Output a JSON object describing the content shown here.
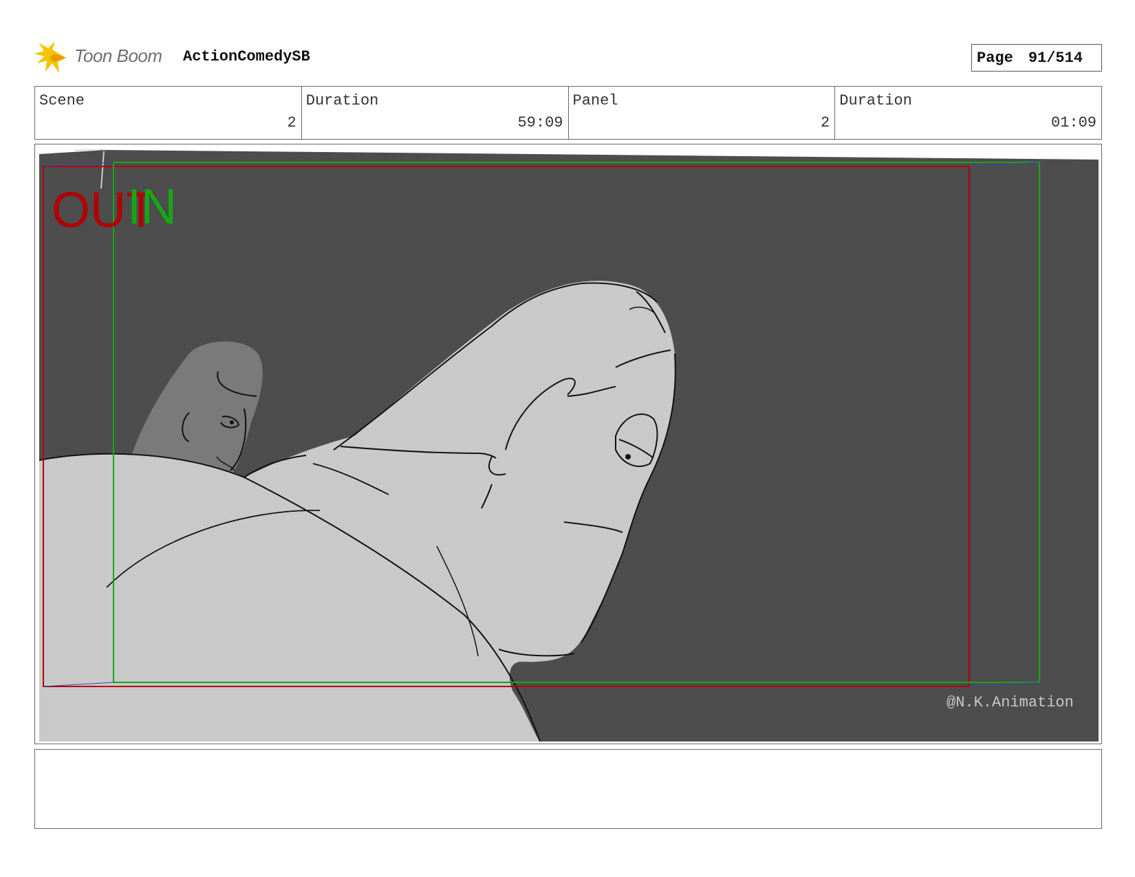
{
  "header": {
    "logo_text": "Toon Boom",
    "project_title": "ActionComedySB",
    "page_label": "Page",
    "page_value": "91/514"
  },
  "info": {
    "scene_label": "Scene",
    "scene_value": "2",
    "scene_duration_label": "Duration",
    "scene_duration_value": "59:09",
    "panel_label": "Panel",
    "panel_value": "2",
    "panel_duration_label": "Duration",
    "panel_duration_value": "01:09"
  },
  "panel": {
    "out_label": "OUT",
    "in_label": "IN",
    "watermark": "@N.K.Animation"
  },
  "notes": {
    "text": ""
  },
  "colors": {
    "background": "#4d4d4d",
    "figure_fill": "#c9c9c9",
    "background_character": "#7a7a7a",
    "out_frame": "#b10000",
    "in_frame": "#14a814",
    "logo_star": "#f5c400"
  }
}
